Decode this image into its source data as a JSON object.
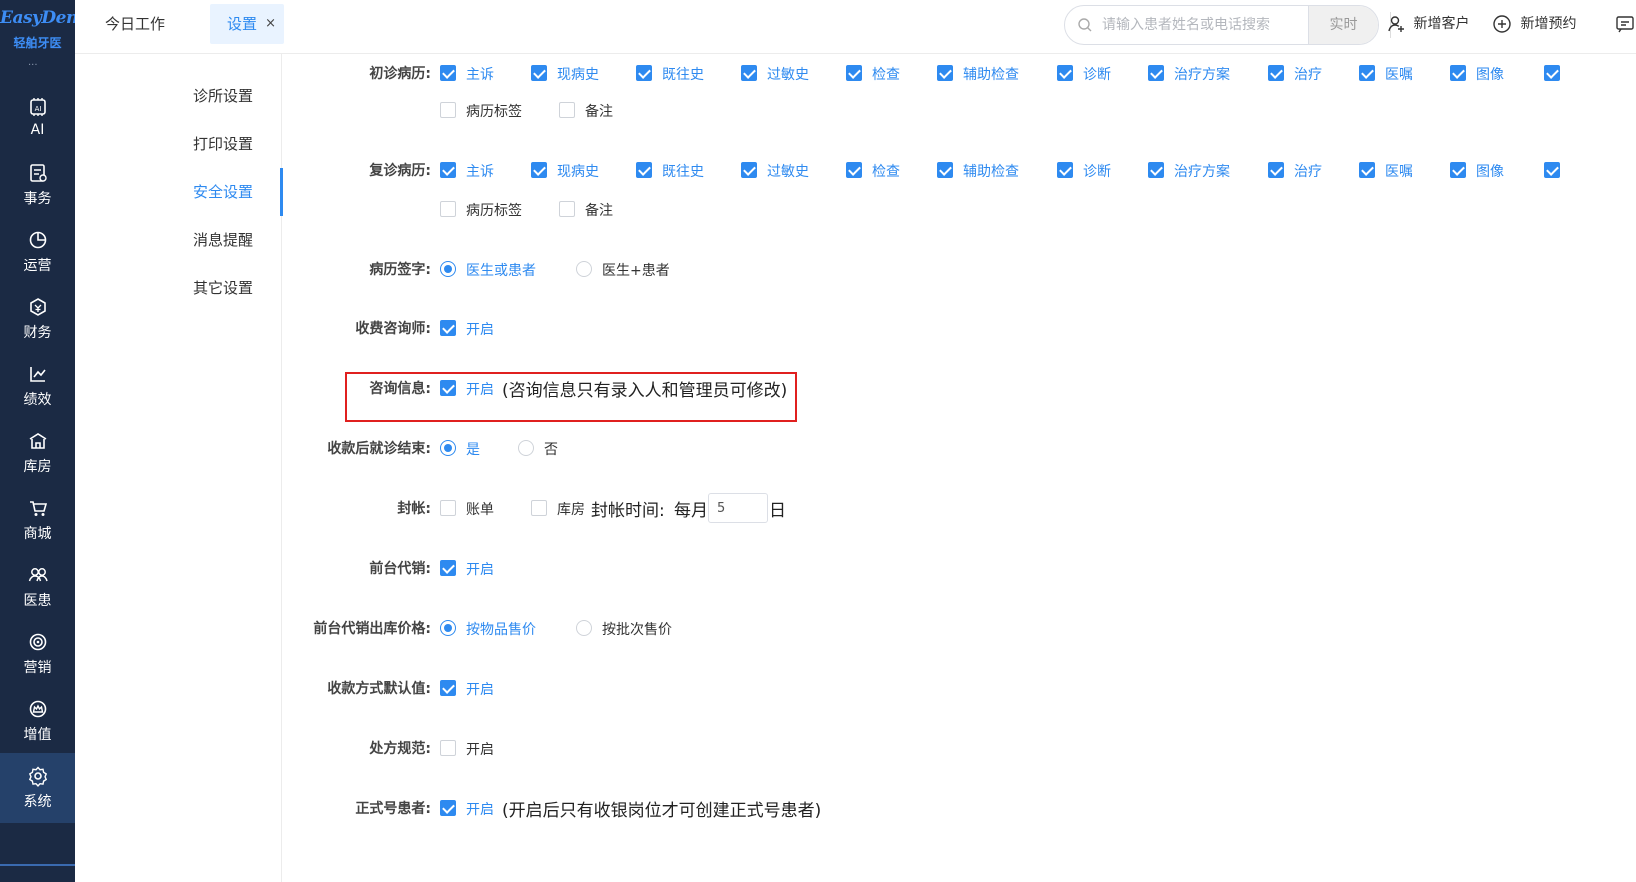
{
  "brand": {
    "name": "EasyDent",
    "name_cn": "轻舶牙医",
    "color": "#3d8df5"
  },
  "sidebar": {
    "items": [
      {
        "label": "AI",
        "icon": "ai-icon"
      },
      {
        "label": "事务",
        "icon": "task-icon"
      },
      {
        "label": "运营",
        "icon": "pie-chart-icon"
      },
      {
        "label": "财务",
        "icon": "finance-icon"
      },
      {
        "label": "绩效",
        "icon": "trend-icon"
      },
      {
        "label": "库房",
        "icon": "warehouse-icon"
      },
      {
        "label": "商城",
        "icon": "cart-icon"
      },
      {
        "label": "医患",
        "icon": "people-icon"
      },
      {
        "label": "营销",
        "icon": "target-icon"
      },
      {
        "label": "增值",
        "icon": "crown-icon"
      },
      {
        "label": "系统",
        "icon": "gear-icon",
        "active": true
      }
    ]
  },
  "topbar": {
    "tabs": [
      {
        "label": "今日工作"
      },
      {
        "label": "设置",
        "active": true,
        "close": "×"
      }
    ],
    "search": {
      "placeholder": "请输入患者姓名或电话搜索",
      "mode_label": "实时"
    },
    "actions": {
      "add_customer": "新增客户",
      "add_appointment": "新增预约"
    }
  },
  "subnav": {
    "items": [
      {
        "label": "诊所设置"
      },
      {
        "label": "打印设置"
      },
      {
        "label": "安全设置",
        "active": true
      },
      {
        "label": "消息提醒"
      },
      {
        "label": "其它设置"
      }
    ]
  },
  "settings": {
    "first_visit": {
      "label": "初诊病历:",
      "options": [
        "主诉",
        "现病史",
        "既往史",
        "过敏史",
        "检查",
        "辅助检查",
        "诊断",
        "治疗方案",
        "治疗",
        "医嘱",
        "图像"
      ],
      "extra": [
        "病历标签",
        "备注"
      ]
    },
    "return_visit": {
      "label": "复诊病历:",
      "options": [
        "主诉",
        "现病史",
        "既往史",
        "过敏史",
        "检查",
        "辅助检查",
        "诊断",
        "治疗方案",
        "治疗",
        "医嘱",
        "图像"
      ],
      "extra": [
        "病历标签",
        "备注"
      ]
    },
    "record_sign": {
      "label": "病历签字:",
      "options": [
        "医生或患者",
        "医生+患者"
      ],
      "selected": 0
    },
    "fee_consultant": {
      "label": "收费咨询师:",
      "option": "开启",
      "checked": true
    },
    "consult_info": {
      "label": "咨询信息:",
      "option": "开启",
      "checked": true,
      "note": "(咨询信息只有录入人和管理员可修改)"
    },
    "end_visit": {
      "label": "收款后就诊结束:",
      "options": [
        "是",
        "否"
      ],
      "selected": 0
    },
    "seal_account": {
      "label": "封帐:",
      "options": [
        "账单",
        "库房"
      ],
      "time_label": "封帐时间:",
      "monthly": "每月",
      "day_value": "5",
      "day_unit": "日"
    },
    "front_consign": {
      "label": "前台代销:",
      "option": "开启",
      "checked": true
    },
    "consign_price": {
      "label": "前台代销出库价格:",
      "options": [
        "按物品售价",
        "按批次售价"
      ],
      "selected": 0
    },
    "payment_default": {
      "label": "收款方式默认值:",
      "option": "开启",
      "checked": true
    },
    "prescription": {
      "label": "处方规范:",
      "option": "开启",
      "checked": false
    },
    "formal_patient": {
      "label": "正式号患者:",
      "option": "开启",
      "checked": true,
      "note": "(开启后只有收银岗位才可创建正式号患者)"
    }
  },
  "colors": {
    "accent": "#2e8af0",
    "sidebar_bg": "#1b2a44",
    "highlight_border": "#e0201f"
  }
}
